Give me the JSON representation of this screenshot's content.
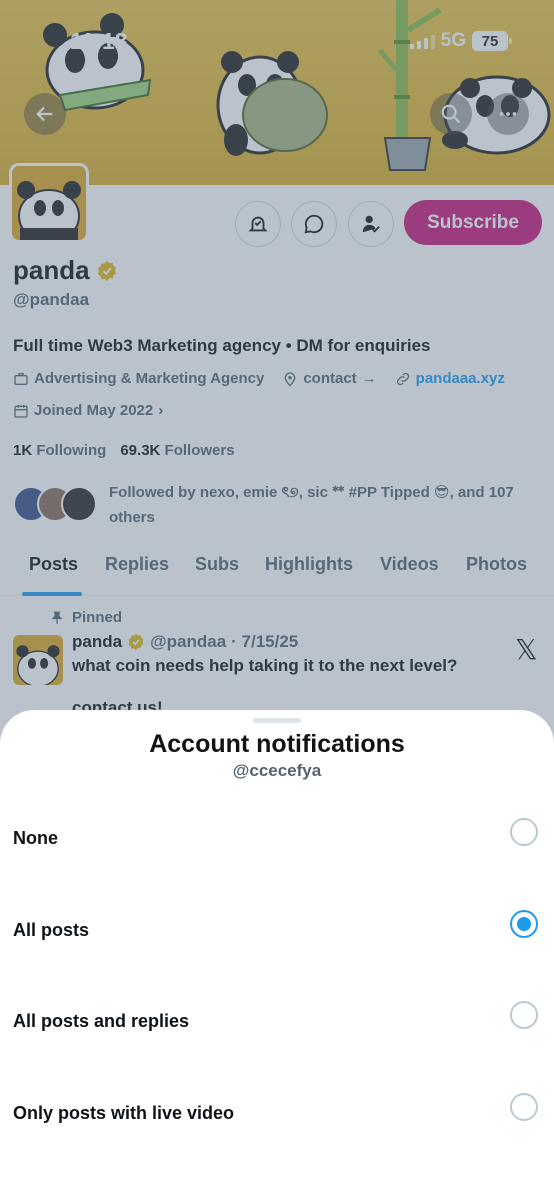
{
  "status_bar": {
    "time": "11:18",
    "network": "5G",
    "battery": "75"
  },
  "profile": {
    "name": "panda",
    "handle": "@pandaa",
    "subscribe_label": "Subscribe",
    "bio": "Full time Web3 Marketing agency • DM for enquiries",
    "category": "Advertising & Marketing Agency",
    "contact_label": "contact",
    "website": "pandaaa.xyz",
    "joined": "Joined May 2022",
    "following_count": "1K",
    "following_label": "Following",
    "followers_count": "69.3K",
    "followers_label": "Followers",
    "followed_by": "Followed by nexo, emie ৎ୭, sic ᕯ #PP Tipped 😎, and 107 others"
  },
  "tabs": [
    {
      "label": "Posts",
      "active": true
    },
    {
      "label": "Replies"
    },
    {
      "label": "Subs"
    },
    {
      "label": "Highlights"
    },
    {
      "label": "Videos"
    },
    {
      "label": "Photos"
    }
  ],
  "pinned_post": {
    "pinned_label": "Pinned",
    "author": "panda",
    "handle": "@pandaa",
    "date": "· 7/15/25",
    "text": "what coin needs help taking it to the next level?",
    "text2": "contact us!",
    "x_glyph": "𝕏"
  },
  "sheet": {
    "title": "Account notifications",
    "subtitle": "@ccecefya",
    "options": [
      {
        "label": "None",
        "selected": false
      },
      {
        "label": "All posts",
        "selected": true
      },
      {
        "label": "All posts and replies",
        "selected": false
      },
      {
        "label": "Only posts with live video",
        "selected": false
      }
    ]
  },
  "colors": {
    "accent": "#1d9bf0",
    "subscribe": "#c9177a",
    "verified": "#e2b719",
    "banner": "#e2b637"
  },
  "icons": [
    "back-arrow-icon",
    "search-icon",
    "more-icon",
    "bell-check-icon",
    "message-icon",
    "person-check-icon",
    "verified-badge-icon",
    "briefcase-icon",
    "location-icon",
    "link-icon",
    "calendar-icon",
    "pin-icon",
    "x-logo-icon"
  ]
}
